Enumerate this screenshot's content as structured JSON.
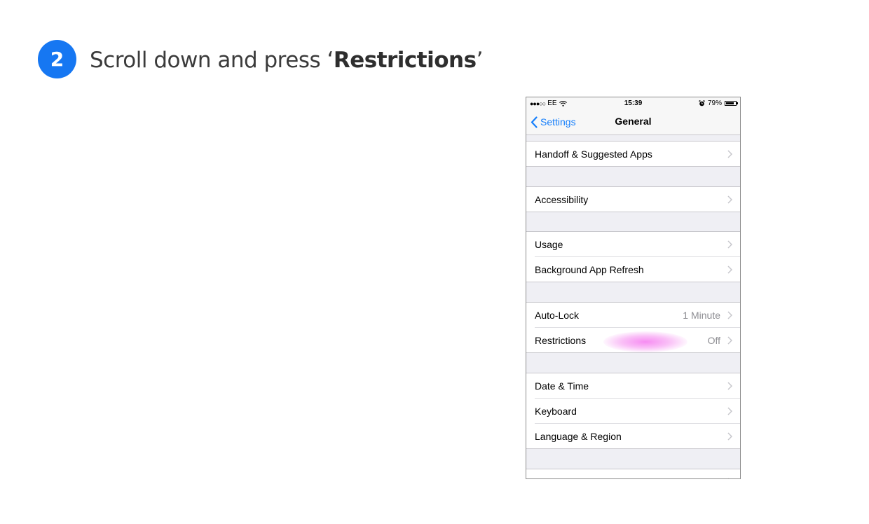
{
  "step": {
    "number": "2",
    "text_before": "Scroll down and press ‘",
    "text_bold": "Restrictions",
    "text_after": "’"
  },
  "phone": {
    "status_bar": {
      "carrier": "EE",
      "time": "15:39",
      "battery": "79%"
    },
    "nav": {
      "back_label": "Settings",
      "title": "General"
    },
    "rows": {
      "handoff": "Handoff & Suggested Apps",
      "accessibility": "Accessibility",
      "usage": "Usage",
      "background_refresh": "Background App Refresh",
      "auto_lock": {
        "label": "Auto-Lock",
        "value": "1 Minute"
      },
      "restrictions": {
        "label": "Restrictions",
        "value": "Off"
      },
      "date_time": "Date & Time",
      "keyboard": "Keyboard",
      "language_region": "Language & Region"
    },
    "colors": {
      "accent": "#147efb",
      "badge": "#1677f2",
      "highlight": "#f578f0"
    }
  }
}
